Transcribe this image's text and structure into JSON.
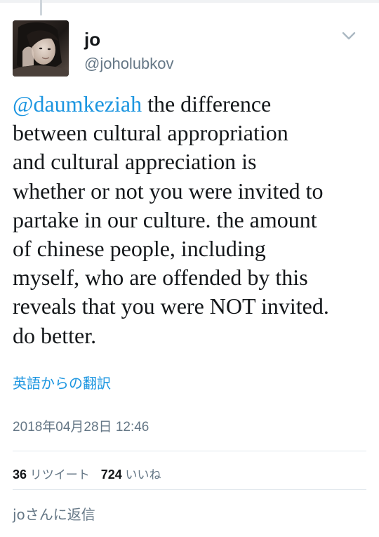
{
  "tweet": {
    "author": {
      "display_name": "jo",
      "handle": "@joholubkov",
      "avatar_icon": "profile-photo"
    },
    "menu_icon": "chevron-down-icon",
    "text_lines": [
      {
        "mention": "@daumkeziah",
        "text": " the difference"
      },
      {
        "mention": "",
        "text": "between cultural appropriation"
      },
      {
        "mention": "",
        "text": "and cultural appreciation is"
      },
      {
        "mention": "",
        "text": "whether or not you were invited to"
      },
      {
        "mention": "",
        "text": "partake in our culture. the amount"
      },
      {
        "mention": "",
        "text": "of chinese people, including"
      },
      {
        "mention": "",
        "text": "myself, who are offended by this"
      },
      {
        "mention": "",
        "text": "reveals that you were NOT invited."
      },
      {
        "mention": "",
        "text": "do better."
      }
    ],
    "translate_label": "英語からの翻訳",
    "timestamp": "2018年04月28日 12:46",
    "stats": {
      "retweet_count": "36",
      "retweet_label": "リツイート",
      "like_count": "724",
      "like_label": "いいね"
    },
    "reply_placeholder": "joさんに返信"
  },
  "colors": {
    "link": "#1b95e0",
    "secondary_text": "#657786",
    "primary_text": "#14171a",
    "divider": "#e1e8ed"
  }
}
